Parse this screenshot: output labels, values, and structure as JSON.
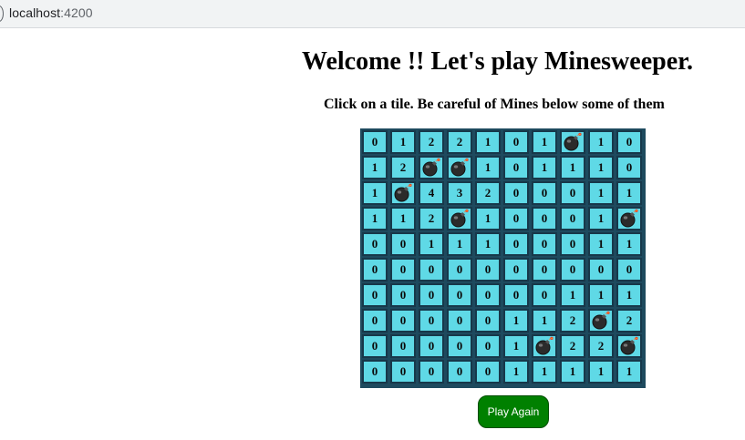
{
  "browser": {
    "host": "localhost",
    "port": ":4200"
  },
  "header": {
    "title": "Welcome !! Let's play Minesweeper.",
    "subtitle": "Click on a tile. Be careful of Mines below some of them"
  },
  "board": {
    "mine_icon": "bomb-icon",
    "colors": {
      "tile": "#5fd9e6",
      "tile_border": "#17384a",
      "board_background": "#1e4a5e"
    },
    "rows": [
      [
        "0",
        "1",
        "2",
        "2",
        "1",
        "0",
        "1",
        "mine",
        "1",
        "0"
      ],
      [
        "1",
        "2",
        "mine",
        "mine",
        "1",
        "0",
        "1",
        "1",
        "1",
        "0"
      ],
      [
        "1",
        "mine",
        "4",
        "3",
        "2",
        "0",
        "0",
        "0",
        "1",
        "1"
      ],
      [
        "1",
        "1",
        "2",
        "mine",
        "1",
        "0",
        "0",
        "0",
        "1",
        "mine"
      ],
      [
        "0",
        "0",
        "1",
        "1",
        "1",
        "0",
        "0",
        "0",
        "1",
        "1"
      ],
      [
        "0",
        "0",
        "0",
        "0",
        "0",
        "0",
        "0",
        "0",
        "0",
        "0"
      ],
      [
        "0",
        "0",
        "0",
        "0",
        "0",
        "0",
        "0",
        "1",
        "1",
        "1"
      ],
      [
        "0",
        "0",
        "0",
        "0",
        "0",
        "1",
        "1",
        "2",
        "mine",
        "2"
      ],
      [
        "0",
        "0",
        "0",
        "0",
        "0",
        "1",
        "mine",
        "2",
        "2",
        "mine"
      ],
      [
        "0",
        "0",
        "0",
        "0",
        "0",
        "1",
        "1",
        "1",
        "1",
        "1"
      ]
    ]
  },
  "actions": {
    "play_again_label": "Play Again",
    "play_again_color": "#008000"
  }
}
